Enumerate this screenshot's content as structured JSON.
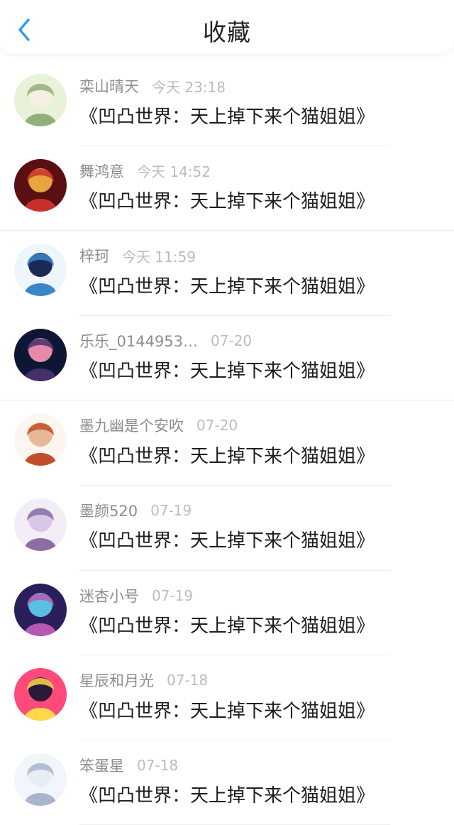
{
  "header": {
    "title": "收藏",
    "back_icon": "chevron-left-icon",
    "accent": "#2f9bec"
  },
  "items": [
    {
      "name": "栾山晴天",
      "time": "今天 23:18",
      "post": "《凹凸世界：天上掉下来个猫姐姐》",
      "avatar_colors": [
        "#e8f2d8",
        "#8fb07a",
        "#f6efe2"
      ]
    },
    {
      "name": "舞鸿意",
      "time": "今天 14:52",
      "post": "《凹凸世界：天上掉下来个猫姐姐》",
      "avatar_colors": [
        "#5a0f12",
        "#c8302c",
        "#e8a440"
      ]
    },
    {
      "name": "梓珂",
      "time": "今天 11:59",
      "post": "《凹凸世界：天上掉下来个猫姐姐》",
      "avatar_colors": [
        "#eef6fb",
        "#3a86c8",
        "#1b2a55"
      ]
    },
    {
      "name": "乐乐_0144953…",
      "time": "07-20",
      "post": "《凹凸世界：天上掉下来个猫姐姐》",
      "avatar_colors": [
        "#0e1635",
        "#44306a",
        "#e58aa8"
      ]
    },
    {
      "name": "墨九幽是个安吹",
      "time": "07-20",
      "post": "《凹凸世界：天上掉下来个猫姐姐》",
      "avatar_colors": [
        "#fbf6f0",
        "#c0502a",
        "#e8b896"
      ]
    },
    {
      "name": "墨颜520",
      "time": "07-19",
      "post": "《凹凸世界：天上掉下来个猫姐姐》",
      "avatar_colors": [
        "#f3eef6",
        "#8a6ea4",
        "#d9c6e4"
      ]
    },
    {
      "name": "迷杏小号",
      "time": "07-19",
      "post": "《凹凸世界：天上掉下来个猫姐姐》",
      "avatar_colors": [
        "#2a1f5a",
        "#b55ab0",
        "#5ac0e0"
      ]
    },
    {
      "name": "星辰和月光",
      "time": "07-18",
      "post": "《凹凸世界：天上掉下来个猫姐姐》",
      "avatar_colors": [
        "#ff4a7a",
        "#ffd84a",
        "#2a1a3a"
      ]
    },
    {
      "name": "笨蛋星",
      "time": "07-18",
      "post": "《凹凸世界：天上掉下来个猫姐姐》",
      "avatar_colors": [
        "#f2f5fa",
        "#a7b6cc",
        "#e8ecf3"
      ]
    }
  ]
}
